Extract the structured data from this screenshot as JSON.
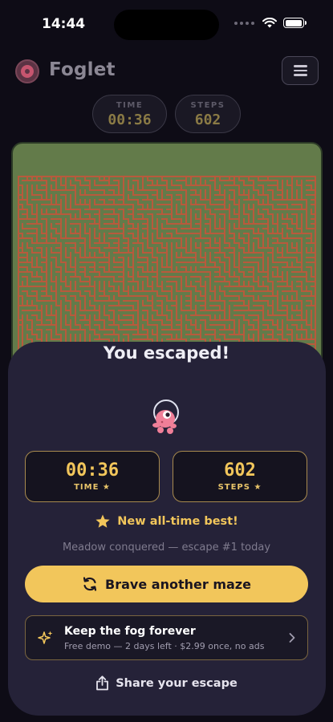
{
  "status_bar": {
    "time": "14:44"
  },
  "app": {
    "name": "Foglet"
  },
  "hud": {
    "time_label": "TIME",
    "time_value": "00:36",
    "steps_label": "STEPS",
    "steps_value": "602"
  },
  "result": {
    "title": "You escaped!",
    "time_value": "00:36",
    "time_label": "TIME ★",
    "steps_value": "602",
    "steps_label": "STEPS ★",
    "best_text": "New all-time best!",
    "conquered_text": "Meadow conquered — escape #1 today",
    "cta_label": "Brave another maze",
    "upsell_title": "Keep the fog forever",
    "upsell_subtitle": "Free demo — 2 days left · $2.99 once, no ads",
    "share_label": "Share your escape"
  },
  "colors": {
    "accent": "#f2c65b",
    "maze_wall": "#b85a3c",
    "maze_path": "#637b4a",
    "sheet_bg": "#252238"
  },
  "icons": [
    "wifi-icon",
    "battery-icon",
    "menu-icon",
    "star-icon",
    "refresh-icon",
    "sparkle-icon",
    "chevron-right-icon",
    "share-icon"
  ]
}
